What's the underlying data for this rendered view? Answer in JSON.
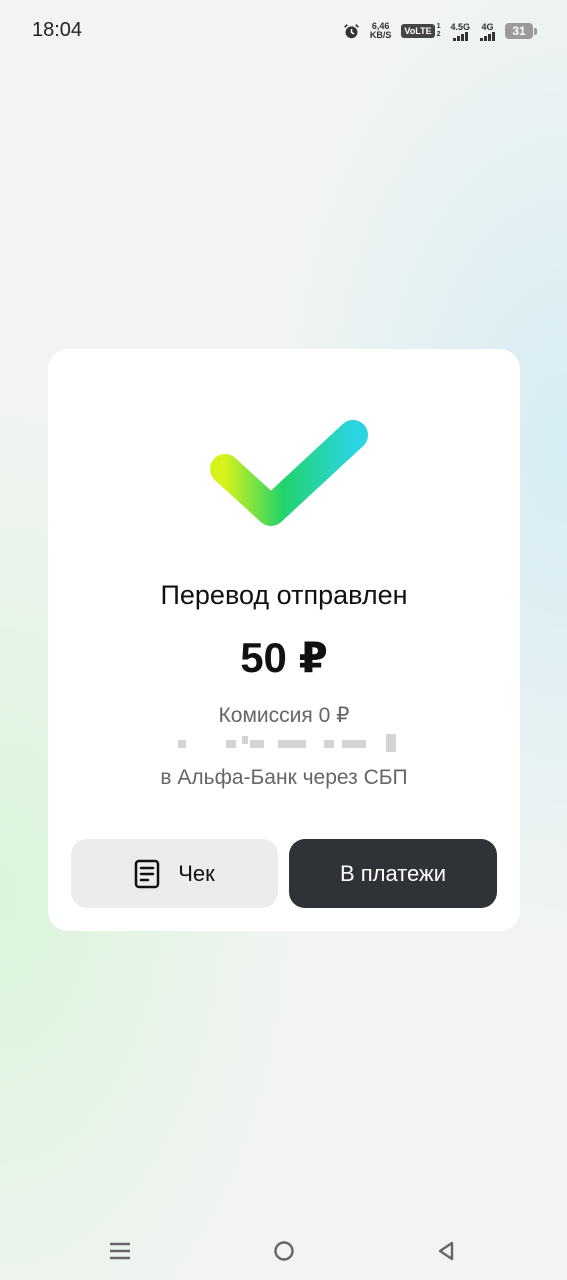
{
  "status_bar": {
    "time": "18:04",
    "speed_value": "6,46",
    "speed_unit": "KB/S",
    "volte": "VoLTE",
    "volte_sims": [
      "1",
      "2"
    ],
    "network_1": "4.5G",
    "network_2": "4G",
    "battery": "31",
    "icons": [
      "alarm-icon",
      "signal-icon",
      "battery-icon"
    ]
  },
  "result": {
    "icon": "checkmark-icon",
    "title": "Перевод отправлен",
    "amount": "50 ₽",
    "commission": "Комиссия 0 ₽",
    "bank": "в Альфа-Банк через СБП"
  },
  "actions": {
    "receipt_label": "Чек",
    "payments_label": "В платежи"
  },
  "navigation": {
    "icons": [
      "menu-icon",
      "home-icon",
      "back-icon"
    ]
  },
  "colors": {
    "primary_button": "#2f3338",
    "secondary_button": "#ececec",
    "check_start": "#d7f21a",
    "check_mid": "#22d36a",
    "check_end": "#2ad4e2"
  }
}
